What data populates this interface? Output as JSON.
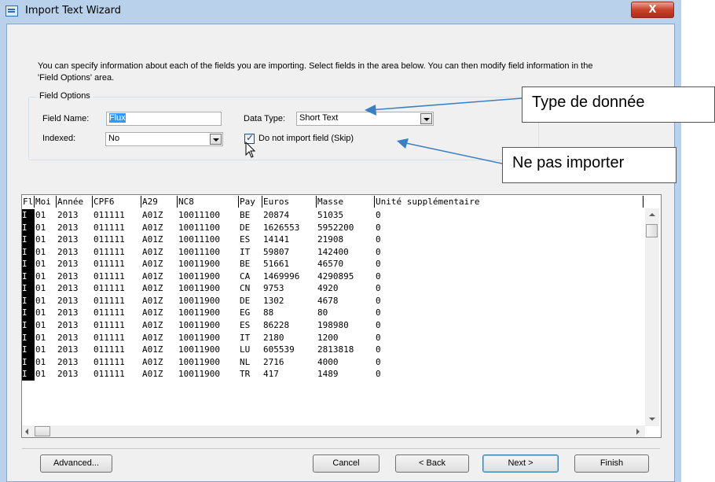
{
  "window": {
    "title": "Import Text Wizard",
    "close_glyph": "X"
  },
  "intro_text": "You can specify information about each of the fields you are importing. Select fields in the area below. You can then modify field information in the 'Field Options' area.",
  "field_options": {
    "group_label": "Field Options",
    "field_name_label": "Field Name:",
    "field_name_value": "Flux",
    "data_type_label": "Data Type:",
    "data_type_value": "Short Text",
    "indexed_label": "Indexed:",
    "indexed_value": "No",
    "skip_label": "Do not import field (Skip)",
    "skip_checked": true
  },
  "callouts": {
    "data_type": "Type de donnée",
    "skip": "Ne pas importer"
  },
  "grid": {
    "columns": [
      "Fl",
      "Moi",
      "Année",
      "CPF6",
      "A29",
      "NC8",
      "Pay",
      "Euros",
      "Masse",
      "Unité supplémentaire"
    ],
    "rows": [
      [
        "I",
        "01",
        "2013",
        "011111",
        "A01Z",
        "10011100",
        "BE",
        "20874",
        "51035",
        "0"
      ],
      [
        "I",
        "01",
        "2013",
        "011111",
        "A01Z",
        "10011100",
        "DE",
        "1626553",
        "5952200",
        "0"
      ],
      [
        "I",
        "01",
        "2013",
        "011111",
        "A01Z",
        "10011100",
        "ES",
        "14141",
        "21908",
        "0"
      ],
      [
        "I",
        "01",
        "2013",
        "011111",
        "A01Z",
        "10011100",
        "IT",
        "59807",
        "142400",
        "0"
      ],
      [
        "I",
        "01",
        "2013",
        "011111",
        "A01Z",
        "10011900",
        "BE",
        "51661",
        "46570",
        "0"
      ],
      [
        "I",
        "01",
        "2013",
        "011111",
        "A01Z",
        "10011900",
        "CA",
        "1469996",
        "4290895",
        "0"
      ],
      [
        "I",
        "01",
        "2013",
        "011111",
        "A01Z",
        "10011900",
        "CN",
        "9753",
        "4920",
        "0"
      ],
      [
        "I",
        "01",
        "2013",
        "011111",
        "A01Z",
        "10011900",
        "DE",
        "1302",
        "4678",
        "0"
      ],
      [
        "I",
        "01",
        "2013",
        "011111",
        "A01Z",
        "10011900",
        "EG",
        "88",
        "80",
        "0"
      ],
      [
        "I",
        "01",
        "2013",
        "011111",
        "A01Z",
        "10011900",
        "ES",
        "86228",
        "198980",
        "0"
      ],
      [
        "I",
        "01",
        "2013",
        "011111",
        "A01Z",
        "10011900",
        "IT",
        "2180",
        "1200",
        "0"
      ],
      [
        "I",
        "01",
        "2013",
        "011111",
        "A01Z",
        "10011900",
        "LU",
        "605539",
        "2813818",
        "0"
      ],
      [
        "I",
        "01",
        "2013",
        "011111",
        "A01Z",
        "10011900",
        "NL",
        "2716",
        "4000",
        "0"
      ],
      [
        "I",
        "01",
        "2013",
        "011111",
        "A01Z",
        "10011900",
        "TR",
        "417",
        "1489",
        "0"
      ]
    ]
  },
  "buttons": {
    "advanced": "Advanced...",
    "cancel": "Cancel",
    "back": "< Back",
    "next": "Next >",
    "finish": "Finish"
  },
  "colors": {
    "accent": "#3a7fc1",
    "selected_column": "#000000"
  }
}
